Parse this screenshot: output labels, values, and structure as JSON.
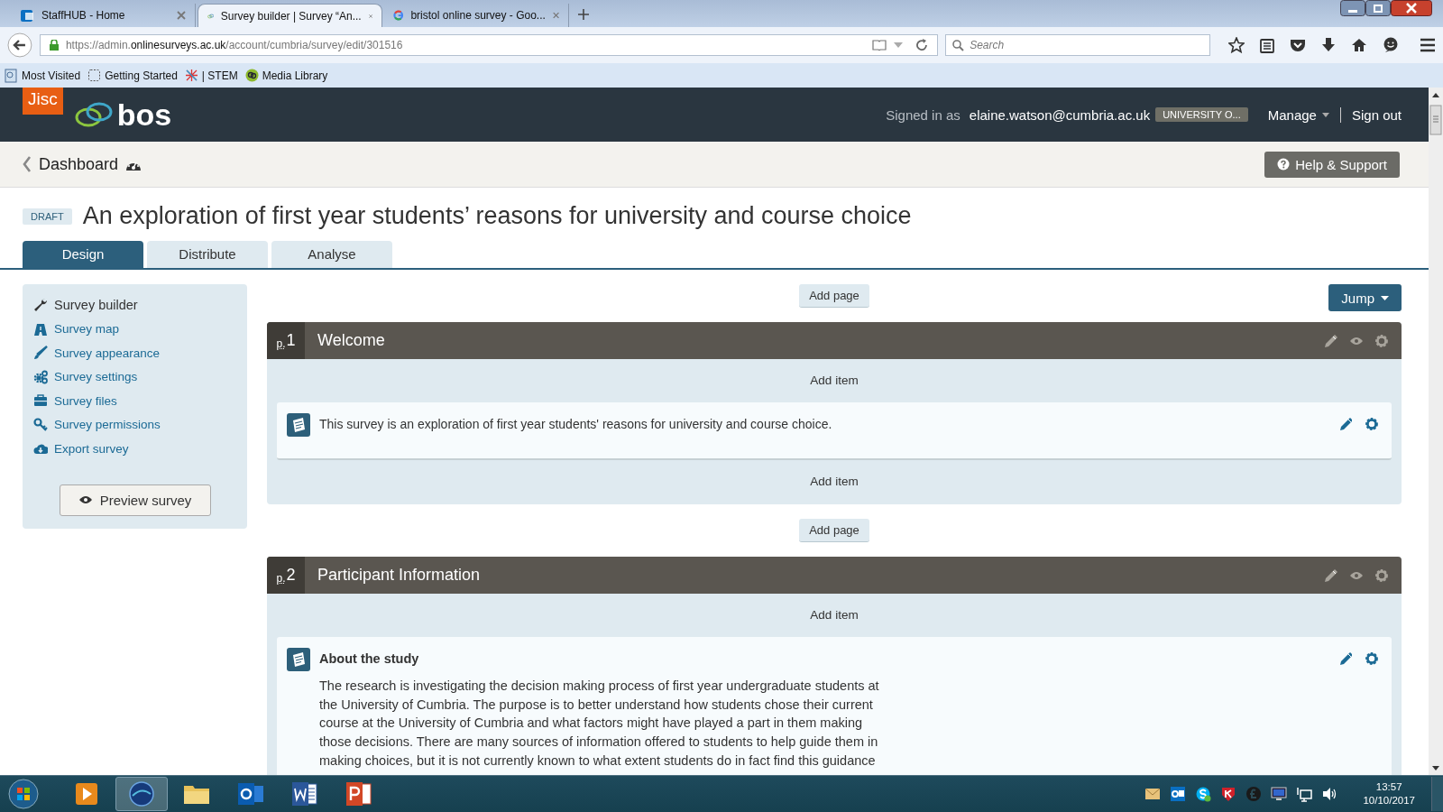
{
  "browser": {
    "tabs": [
      {
        "title": "StaffHUB - Home",
        "selected": false,
        "kind": "sharepoint"
      },
      {
        "title": "Survey builder | Survey “An...",
        "selected": true,
        "kind": "bos"
      },
      {
        "title": "bristol online survey - Goo...",
        "selected": false,
        "kind": "google"
      }
    ],
    "url": {
      "prefix": "https://admin.",
      "domain": "onlinesurveys.ac.uk",
      "path": "/account/cumbria/survey/edit/301516"
    },
    "search": {
      "placeholder": "Search"
    },
    "bookmarks": [
      {
        "label": "Most Visited",
        "kind": "history"
      },
      {
        "label": "Getting Started",
        "kind": "dotted"
      },
      {
        "label": "| STEM",
        "kind": "stem"
      },
      {
        "label": "Media Library",
        "kind": "media"
      }
    ]
  },
  "app_header": {
    "logo": "Jisc",
    "product": "bos",
    "signed_in_label": "Signed in as",
    "user": "elaine.watson@cumbria.ac.uk",
    "organisation": "UNIVERSITY O...",
    "manage": "Manage",
    "sign_out": "Sign out"
  },
  "breadcrumb": {
    "label": "Dashboard",
    "help": "Help & Support"
  },
  "survey": {
    "status": "DRAFT",
    "title": "An exploration of first year students’ reasons for university and course choice"
  },
  "tabs": [
    {
      "label": "Design",
      "selected": true
    },
    {
      "label": "Distribute",
      "selected": false
    },
    {
      "label": "Analyse",
      "selected": false
    }
  ],
  "sidebar": {
    "items": [
      {
        "label": "Survey builder",
        "kind": "wrench",
        "selected": true
      },
      {
        "label": "Survey map",
        "kind": "map",
        "selected": false
      },
      {
        "label": "Survey appearance",
        "kind": "brush",
        "selected": false
      },
      {
        "label": "Survey settings",
        "kind": "cogs",
        "selected": false
      },
      {
        "label": "Survey files",
        "kind": "briefcase",
        "selected": false
      },
      {
        "label": "Survey permissions",
        "kind": "key",
        "selected": false
      },
      {
        "label": "Export survey",
        "kind": "cloud",
        "selected": false
      }
    ],
    "preview": "Preview survey"
  },
  "builder": {
    "jump": "Jump",
    "pages": [
      {
        "add_page": "Add page",
        "prefix": "p.",
        "number": "1",
        "title": "Welcome",
        "add_item_top": "Add item",
        "items": [
          {
            "text": "This survey is an exploration of first year students' reasons for university and course choice."
          }
        ],
        "add_item_bottom": "Add item"
      },
      {
        "add_page": "Add page",
        "prefix": "p.",
        "number": "2",
        "title": "Participant Information",
        "add_item_top": "Add item",
        "items": [
          {
            "heading": "About the study",
            "text": "The research is investigating the decision making process of first year undergraduate students at the University of Cumbria. The purpose is to better understand how students chose their current course at the University of Cumbria and what factors might have played a part in them making those decisions. There are many sources of information offered to students to help guide them in making choices, but it is not currently known to what extent students do in fact find this guidance"
          }
        ]
      }
    ]
  },
  "taskbar": {
    "apps": [
      {
        "kind": "media",
        "selected": false
      },
      {
        "kind": "globe",
        "selected": true
      },
      {
        "kind": "folder",
        "selected": false
      },
      {
        "kind": "outlook",
        "selected": false
      },
      {
        "kind": "word",
        "selected": false
      },
      {
        "kind": "powerpoint",
        "selected": false
      }
    ],
    "tray": [
      {
        "kind": "mail"
      },
      {
        "kind": "outlook"
      },
      {
        "kind": "skype"
      },
      {
        "kind": "antivirus"
      },
      {
        "kind": "pound"
      },
      {
        "kind": "monitor"
      },
      {
        "kind": "network"
      },
      {
        "kind": "volume"
      }
    ],
    "time": "13:57",
    "date": "10/10/2017"
  }
}
